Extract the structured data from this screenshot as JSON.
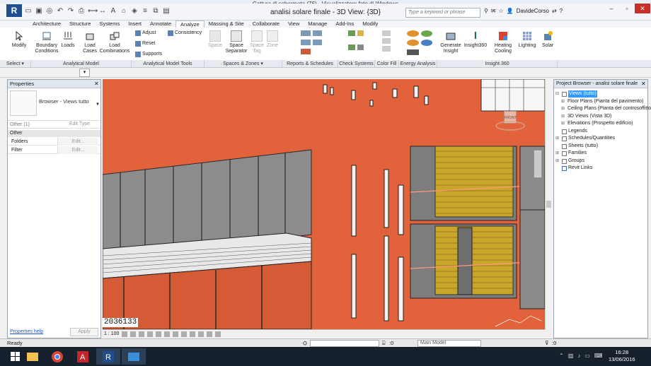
{
  "outer_window": {
    "title": "Cattura di schermata (76) - Visualizzatore foto di Windows"
  },
  "app": {
    "button_label": "R",
    "document_title": "analisi solare finale - 3D View: {3D}",
    "search_placeholder": "Type a keyword or phrase",
    "user_name": "DavideCorso",
    "help_label": "?"
  },
  "ribbon_tabs": [
    "Architecture",
    "Structure",
    "Systems",
    "Insert",
    "Annotate",
    "Analyze",
    "Massing & Site",
    "Collaborate",
    "View",
    "Manage",
    "Add-Ins",
    "Modify"
  ],
  "active_tab": "Analyze",
  "ribbon": {
    "modify": "Modify",
    "boundary_conditions": "Boundary Conditions",
    "loads": "Loads",
    "load_cases": "Load Cases",
    "load_combinations": "Load Combinations",
    "adjust": "Adjust",
    "reset": "Reset",
    "supports": "Supports",
    "consistency": "Consistency",
    "space": "Space",
    "space_separator": "Space Separator",
    "space_tag": "Space Tag",
    "zone": "Zone",
    "generate_insight": "Generate Insight",
    "insight360": "Insight360",
    "heating_cooling": "Heating Cooling",
    "lighting": "Lighting",
    "solar": "Solar"
  },
  "panel_labels": [
    "Select ▾",
    "Analytical Model",
    "Analytical Model Tools",
    "Spaces & Zones ▾",
    "Reports & Schedules",
    "Check Systems",
    "Color Fill",
    "Energy Analysis",
    "Insight 360"
  ],
  "properties": {
    "title": "Properties",
    "type_name": "Browser - Views tutto",
    "filter": "Other (1)",
    "edit_type": "Edit Type",
    "group": "Other",
    "rows": [
      {
        "key": "Folders",
        "value": "Edit..."
      },
      {
        "key": "Filter",
        "value": "Edit..."
      }
    ],
    "help_link": "Properties help",
    "apply": "Apply"
  },
  "viewport": {
    "selection_id": "2036133",
    "viewcube_label": "FRONT",
    "scale": "1 : 100"
  },
  "project_browser": {
    "title": "Project Browser - analisi solare finale",
    "items": [
      {
        "label": "Views (tutto)",
        "level": 0,
        "expander": "⊟",
        "selected": true
      },
      {
        "label": "Floor Plans (Pianta del pavimento)",
        "level": 1,
        "expander": "⊞",
        "selected": false
      },
      {
        "label": "Ceiling Plans (Pianta del controsoffitto)",
        "level": 1,
        "expander": "⊞",
        "selected": false
      },
      {
        "label": "3D Views (Vista 3D)",
        "level": 1,
        "expander": "⊞",
        "selected": false
      },
      {
        "label": "Elevations (Prospetto edificio)",
        "level": 1,
        "expander": "⊞",
        "selected": false
      },
      {
        "label": "Legends",
        "level": 0,
        "expander": "",
        "selected": false
      },
      {
        "label": "Schedules/Quantities",
        "level": 0,
        "expander": "⊞",
        "selected": false
      },
      {
        "label": "Sheets (tutto)",
        "level": 0,
        "expander": "",
        "selected": false
      },
      {
        "label": "Families",
        "level": 0,
        "expander": "⊞",
        "selected": false
      },
      {
        "label": "Groups",
        "level": 0,
        "expander": "⊞",
        "selected": false
      },
      {
        "label": "Revit Links",
        "level": 0,
        "expander": "",
        "selected": false
      }
    ]
  },
  "status_bar": {
    "text": "Ready",
    "coord_value": ":0",
    "model": "Main Model"
  },
  "taskbar": {
    "time": "16:28",
    "date": "13/06/2016"
  },
  "colors": {
    "facade": "#e2623b",
    "louver": "#c9a52a",
    "taskbar": "#17212e",
    "selection": "#3399ff"
  }
}
